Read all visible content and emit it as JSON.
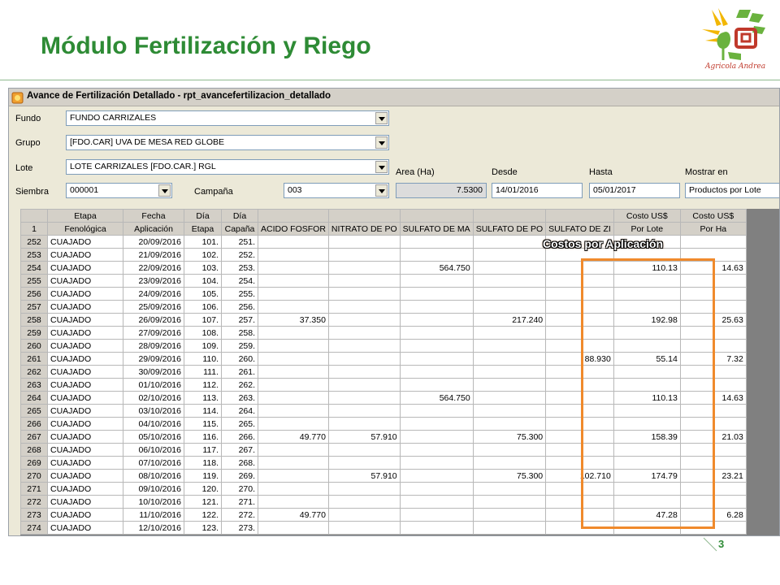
{
  "slide": {
    "title": "Módulo Fertilización y Riego",
    "logo_text": "Agricola Andrea",
    "page_number": "3",
    "callout": "Costos por Aplicación",
    "accent_color": "#2e8b35",
    "highlight_color": "#f08a2c"
  },
  "window": {
    "title": "Avance de Fertilización Detallado - rpt_avancefertilizacion_detallado",
    "icon": "report-icon"
  },
  "filters": {
    "fundo_label": "Fundo",
    "fundo_value": "FUNDO CARRIZALES",
    "grupo_label": "Grupo",
    "grupo_value": "[FDO.CAR] UVA DE MESA RED GLOBE",
    "lote_label": "Lote",
    "lote_value": "LOTE CARRIZALES [FDO.CAR.] RGL",
    "siembra_label": "Siembra",
    "siembra_value": "000001",
    "campana_label": "Campaña",
    "campana_value": "003",
    "area_label": "Area (Ha)",
    "area_value": "7.5300",
    "desde_label": "Desde",
    "desde_value": "14/01/2016",
    "hasta_label": "Hasta",
    "hasta_value": "05/01/2017",
    "mostrar_label": "Mostrar en",
    "mostrar_value": "Productos por Lote"
  },
  "grid": {
    "header1": [
      "",
      "Etapa",
      "Fecha",
      "Día",
      "Día",
      "",
      "",
      "",
      "",
      "",
      "Costo US$",
      "Costo US$"
    ],
    "header2": [
      "1",
      "Fenológica",
      "Aplicación",
      "Etapa",
      "Capaña",
      "ACIDO FOSFOR",
      "NITRATO DE PO",
      "SULFATO DE MA",
      "SULFATO DE PO",
      "SULFATO DE ZI",
      "Por Lote",
      "Por Ha"
    ],
    "rows": [
      [
        "252",
        "CUAJADO",
        "20/09/2016",
        "101.",
        "251.",
        "",
        "",
        "",
        "",
        "",
        "",
        ""
      ],
      [
        "253",
        "CUAJADO",
        "21/09/2016",
        "102.",
        "252.",
        "",
        "",
        "",
        "",
        "",
        "",
        ""
      ],
      [
        "254",
        "CUAJADO",
        "22/09/2016",
        "103.",
        "253.",
        "",
        "",
        "564.750",
        "",
        "",
        "110.13",
        "14.63"
      ],
      [
        "255",
        "CUAJADO",
        "23/09/2016",
        "104.",
        "254.",
        "",
        "",
        "",
        "",
        "",
        "",
        ""
      ],
      [
        "256",
        "CUAJADO",
        "24/09/2016",
        "105.",
        "255.",
        "",
        "",
        "",
        "",
        "",
        "",
        ""
      ],
      [
        "257",
        "CUAJADO",
        "25/09/2016",
        "106.",
        "256.",
        "",
        "",
        "",
        "",
        "",
        "",
        ""
      ],
      [
        "258",
        "CUAJADO",
        "26/09/2016",
        "107.",
        "257.",
        "37.350",
        "",
        "",
        "217.240",
        "",
        "192.98",
        "25.63"
      ],
      [
        "259",
        "CUAJADO",
        "27/09/2016",
        "108.",
        "258.",
        "",
        "",
        "",
        "",
        "",
        "",
        ""
      ],
      [
        "260",
        "CUAJADO",
        "28/09/2016",
        "109.",
        "259.",
        "",
        "",
        "",
        "",
        "",
        "",
        ""
      ],
      [
        "261",
        "CUAJADO",
        "29/09/2016",
        "110.",
        "260.",
        "",
        "",
        "",
        "",
        "88.930",
        "55.14",
        "7.32"
      ],
      [
        "262",
        "CUAJADO",
        "30/09/2016",
        "111.",
        "261.",
        "",
        "",
        "",
        "",
        "",
        "",
        ""
      ],
      [
        "263",
        "CUAJADO",
        "01/10/2016",
        "112.",
        "262.",
        "",
        "",
        "",
        "",
        "",
        "",
        ""
      ],
      [
        "264",
        "CUAJADO",
        "02/10/2016",
        "113.",
        "263.",
        "",
        "",
        "564.750",
        "",
        "",
        "110.13",
        "14.63"
      ],
      [
        "265",
        "CUAJADO",
        "03/10/2016",
        "114.",
        "264.",
        "",
        "",
        "",
        "",
        "",
        "",
        ""
      ],
      [
        "266",
        "CUAJADO",
        "04/10/2016",
        "115.",
        "265.",
        "",
        "",
        "",
        "",
        "",
        "",
        ""
      ],
      [
        "267",
        "CUAJADO",
        "05/10/2016",
        "116.",
        "266.",
        "49.770",
        "57.910",
        "",
        "75.300",
        "",
        "158.39",
        "21.03"
      ],
      [
        "268",
        "CUAJADO",
        "06/10/2016",
        "117.",
        "267.",
        "",
        "",
        "",
        "",
        "",
        "",
        ""
      ],
      [
        "269",
        "CUAJADO",
        "07/10/2016",
        "118.",
        "268.",
        "",
        "",
        "",
        "",
        "",
        "",
        ""
      ],
      [
        "270",
        "CUAJADO",
        "08/10/2016",
        "119.",
        "269.",
        "",
        "57.910",
        "",
        "75.300",
        "102.710",
        "174.79",
        "23.21"
      ],
      [
        "271",
        "CUAJADO",
        "09/10/2016",
        "120.",
        "270.",
        "",
        "",
        "",
        "",
        "",
        "",
        ""
      ],
      [
        "272",
        "CUAJADO",
        "10/10/2016",
        "121.",
        "271.",
        "",
        "",
        "",
        "",
        "",
        "",
        ""
      ],
      [
        "273",
        "CUAJADO",
        "11/10/2016",
        "122.",
        "272.",
        "49.770",
        "",
        "",
        "",
        "",
        "47.28",
        "6.28"
      ],
      [
        "274",
        "CUAJADO",
        "12/10/2016",
        "123.",
        "273.",
        "",
        "",
        "",
        "",
        "",
        "",
        ""
      ]
    ]
  }
}
